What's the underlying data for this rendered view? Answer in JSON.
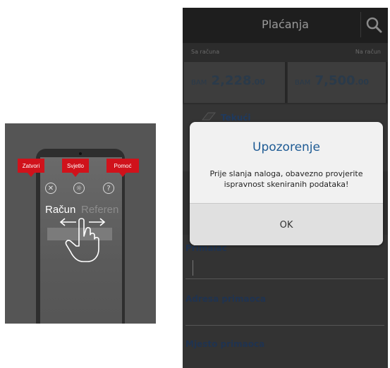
{
  "tutorial": {
    "tags": [
      "Zatvori",
      "Svjetlo",
      "Pomoć"
    ],
    "label_active": "Račun",
    "label_inactive": "Referen"
  },
  "app": {
    "title": "Plaćanja",
    "from_label": "Sa računa",
    "to_label": "Na račun",
    "from_account": {
      "currency": "BAM",
      "amount": "2,228",
      "decimals": ".00"
    },
    "to_account": {
      "currency": "BAM",
      "amount": "7,500",
      "decimals": ".00"
    },
    "account_type": "Tekući",
    "form": {
      "recipient_label": "Primalac",
      "address_label": "Adresa primaoca",
      "city_label": "Mjesto primaoca"
    }
  },
  "dialog": {
    "title": "Upozorenje",
    "message": "Prije slanja naloga, obavezno provjerite ispravnost skeniranih podataka!",
    "ok_label": "OK"
  },
  "colors": {
    "tag_red": "#d0121b",
    "dialog_title": "#1e5b94",
    "dark_header": "#1e1e1e"
  }
}
